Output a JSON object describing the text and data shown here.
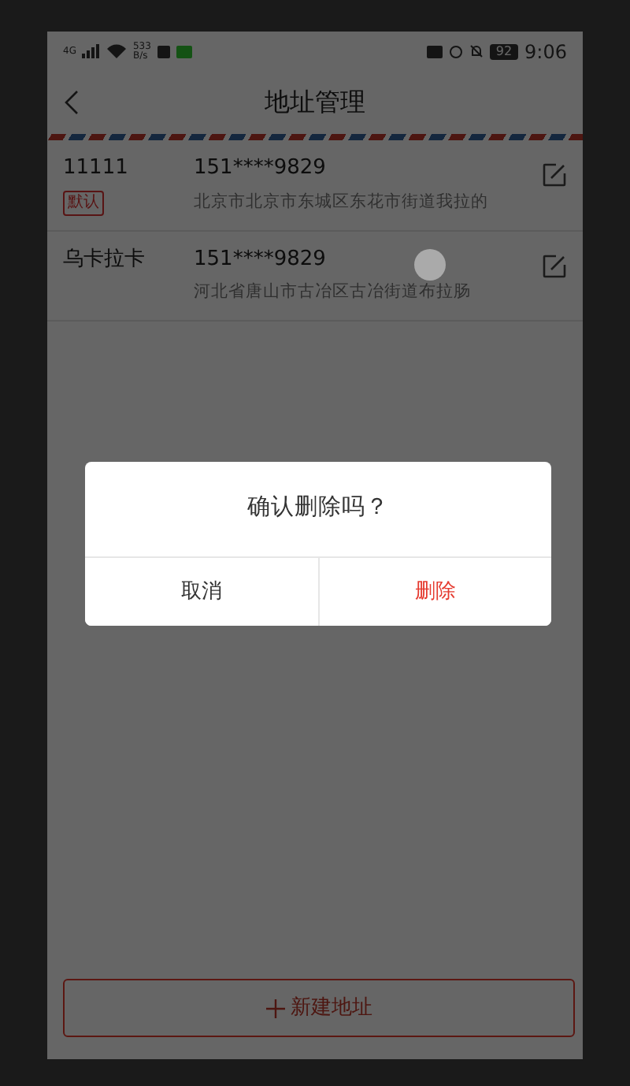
{
  "status_bar": {
    "network": "4G",
    "speed": "533\nB/s",
    "battery": "92",
    "time": "9:06"
  },
  "header": {
    "title": "地址管理"
  },
  "addresses": [
    {
      "name": "11111",
      "phone": "151****9829",
      "address": "北京市北京市东城区东花市街道我拉的",
      "tag": "默认"
    },
    {
      "name": "乌卡拉卡",
      "phone": "151****9829",
      "address": "河北省唐山市古冶区古冶街道布拉肠"
    }
  ],
  "dialog": {
    "message": "确认删除吗？",
    "buttons": [
      {
        "label": "取消",
        "kind": "cancel"
      },
      {
        "label": "删除",
        "kind": "danger"
      }
    ]
  },
  "new_button": {
    "label": "新建地址"
  }
}
